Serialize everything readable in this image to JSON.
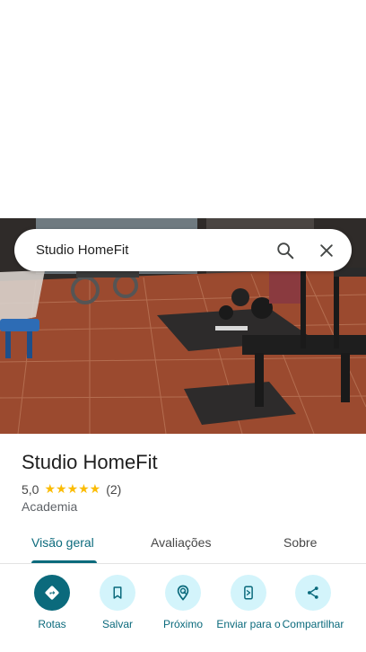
{
  "search": {
    "query": "Studio HomeFit",
    "search_icon": "search-icon",
    "close_icon": "close-icon"
  },
  "place": {
    "name": "Studio HomeFit",
    "rating": "5,0",
    "stars": "★★★★★",
    "review_count": "(2)",
    "category": "Academia"
  },
  "tabs": [
    {
      "label": "Visão geral",
      "active": true
    },
    {
      "label": "Avaliações",
      "active": false
    },
    {
      "label": "Sobre",
      "active": false
    }
  ],
  "actions": [
    {
      "label": "Rotas",
      "icon": "directions-icon"
    },
    {
      "label": "Salvar",
      "icon": "bookmark-icon"
    },
    {
      "label": "Próximo",
      "icon": "nearby-icon"
    },
    {
      "label": "Enviar para o",
      "icon": "send-to-phone-icon"
    },
    {
      "label": "Compartilhar",
      "icon": "share-icon"
    }
  ],
  "colors": {
    "accent": "#0b6a7c",
    "action_bg": "#d3f4fb",
    "star": "#fbbc04"
  }
}
